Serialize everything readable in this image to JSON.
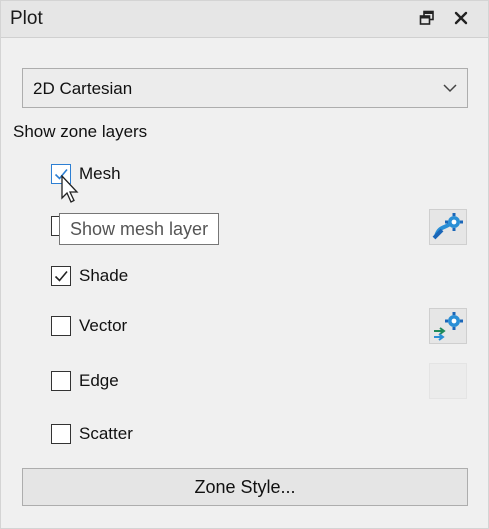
{
  "panel": {
    "title": "Plot",
    "float_icon": "float-window-icon",
    "close_icon": "close-icon"
  },
  "plot_type": {
    "selected": "2D Cartesian"
  },
  "zone_layers": {
    "heading": "Show zone layers",
    "items": [
      {
        "label": "Mesh",
        "checked": true,
        "style_button": "none"
      },
      {
        "label": "",
        "checked": false,
        "style_button": "contour-settings-icon"
      },
      {
        "label": "Shade",
        "checked": true,
        "style_button": "none"
      },
      {
        "label": "Vector",
        "checked": false,
        "style_button": "vector-settings-icon"
      },
      {
        "label": "Edge",
        "checked": false,
        "style_button": "disabled"
      },
      {
        "label": "Scatter",
        "checked": false,
        "style_button": "none"
      }
    ]
  },
  "zone_style_button": "Zone Style...",
  "tooltip": "Show mesh layer",
  "colors": {
    "panel_bg": "#f0f0f0",
    "titlebar_bg": "#e6e6e6",
    "accent": "#2d7fd3"
  }
}
